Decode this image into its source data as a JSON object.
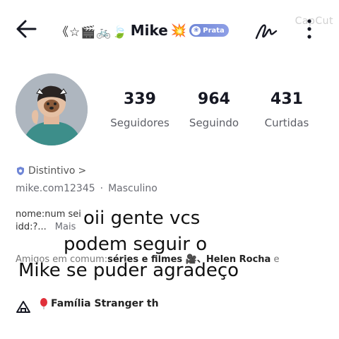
{
  "header": {
    "back_icon": "arrow-left-icon",
    "title_prefix": "《☆🎬🚲🍃",
    "username": "Mike",
    "title_suffix": "💥",
    "badge_label": "Prata",
    "watermark": "CapCut",
    "sign_icon": "signature-icon",
    "more_icon": "vertical-dots-icon"
  },
  "stats": [
    {
      "value": "339",
      "label": "Seguidores"
    },
    {
      "value": "964",
      "label": "Seguindo"
    },
    {
      "value": "431",
      "label": "Curtidas"
    }
  ],
  "bio": {
    "distintivo_label": "Distintivo",
    "distintivo_chevron": ">",
    "handle": "mike.com12345",
    "separator": "·",
    "gender": "Masculino",
    "line1": "nome:num sei",
    "line2": "idd:?...",
    "more_label": "Mais",
    "friends_prefix": "Amigos em comum:",
    "friends_names": "séries e filmes 🎥、Helen Rocha",
    "friends_suffix": "e"
  },
  "overlay": {
    "line1": "oii gente vcs",
    "line2": "podem seguir o",
    "line3": "Mike se puder agradeço"
  },
  "bottom": {
    "family_text": "Família Stranger th"
  },
  "colors": {
    "badge": "#7c90dd",
    "text_primary": "#161823",
    "text_secondary": "#6b6d75",
    "balloon": "#e0303a"
  }
}
